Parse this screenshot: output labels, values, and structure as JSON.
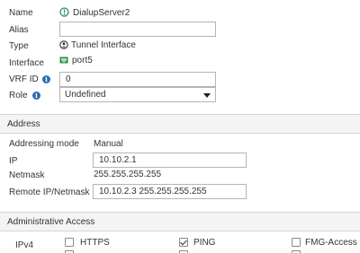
{
  "fields": {
    "name_label": "Name",
    "name_value": "DialupServer2",
    "alias_label": "Alias",
    "alias_value": "",
    "type_label": "Type",
    "type_value": "Tunnel Interface",
    "interface_label": "Interface",
    "interface_value": "port5",
    "vrf_label": "VRF ID",
    "vrf_value": "0",
    "role_label": "Role",
    "role_value": "Undefined"
  },
  "address": {
    "header": "Address",
    "mode_label": "Addressing mode",
    "mode_value": "Manual",
    "ip_label": "IP",
    "ip_value": "10.10.2.1",
    "netmask_label": "Netmask",
    "netmask_value": "255.255.255.255",
    "remote_label": "Remote IP/Netmask",
    "remote_value": "10.10.2.3 255.255.255.255"
  },
  "admin_access": {
    "header": "Administrative Access",
    "ipv4_label": "IPv4",
    "options": [
      {
        "label": "HTTPS",
        "checked": false
      },
      {
        "label": "PING",
        "checked": true
      },
      {
        "label": "FMG-Access",
        "checked": false
      }
    ]
  },
  "colors": {
    "accent": "#2b6cb0",
    "status_green": "#2e8b57",
    "section_bg": "#f4f4f4"
  }
}
